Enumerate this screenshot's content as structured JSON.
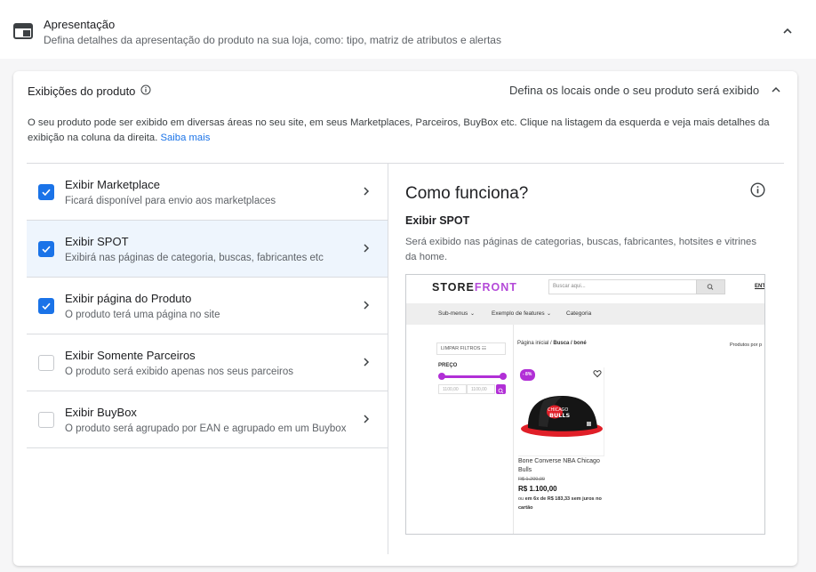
{
  "header": {
    "title": "Apresentação",
    "description": "Defina detalhes da apresentação do produto na sua loja, como: tipo, matriz de atributos e alertas"
  },
  "card": {
    "title": "Exibições do produto",
    "right_text": "Defina os locais onde o seu produto será exibido",
    "description": "O seu produto pode ser exibido em diversas áreas no seu site, em seus Marketplaces, Parceiros, BuyBox etc. Clique na listagem da esquerda e veja mais detalhes da exibição na coluna da direita.",
    "learn_more": "Saiba mais"
  },
  "items": [
    {
      "title": "Exibir Marketplace",
      "desc": "Ficará disponível para envio aos marketplaces",
      "checked": true,
      "selected": false
    },
    {
      "title": "Exibir SPOT",
      "desc": "Exibirá nas páginas de categoria, buscas, fabricantes etc",
      "checked": true,
      "selected": true
    },
    {
      "title": "Exibir página do Produto",
      "desc": "O produto terá uma página no site",
      "checked": true,
      "selected": false
    },
    {
      "title": "Exibir Somente Parceiros",
      "desc": "O produto será exibido apenas nos seus parceiros",
      "checked": false,
      "selected": false
    },
    {
      "title": "Exibir BuyBox",
      "desc": "O produto será agrupado por EAN e agrupado em um Buybox",
      "checked": false,
      "selected": false
    }
  ],
  "detail": {
    "title": "Como funciona?",
    "subtitle": "Exibir SPOT",
    "description": "Será exibido nas páginas de categorias, buscas, fabricantes, hotsites e vitrines da home."
  },
  "preview": {
    "logo_store": "STORE",
    "logo_front": "FRONT",
    "search_placeholder": "Buscar aqui...",
    "header_link": "ENT",
    "nav": [
      "Sub-menus",
      "Exemplo de features",
      "Categoria"
    ],
    "clear_filters": "LIMPAR FILTROS",
    "price_label": "PREÇO",
    "min_placeholder": "1100,00",
    "max_placeholder": "1100,00",
    "breadcrumb_home": "Página inicial / ",
    "breadcrumb_path": "Busca / boné",
    "products_label": "Produtos por p",
    "product": {
      "badge": "- 8%",
      "name": "Bone Converse NBA Chicago Bulls",
      "old_price": "R$ 1.200,00",
      "price": "R$ 1.100,00",
      "installments_prefix": "ou ",
      "installments_bold": "em 6x de R$ 183,33 sem juros no cartão"
    }
  },
  "colors": {
    "accent": "#1a73e8",
    "selected_row": "#eef5fd",
    "storefront_purple": "#b12fd6"
  }
}
